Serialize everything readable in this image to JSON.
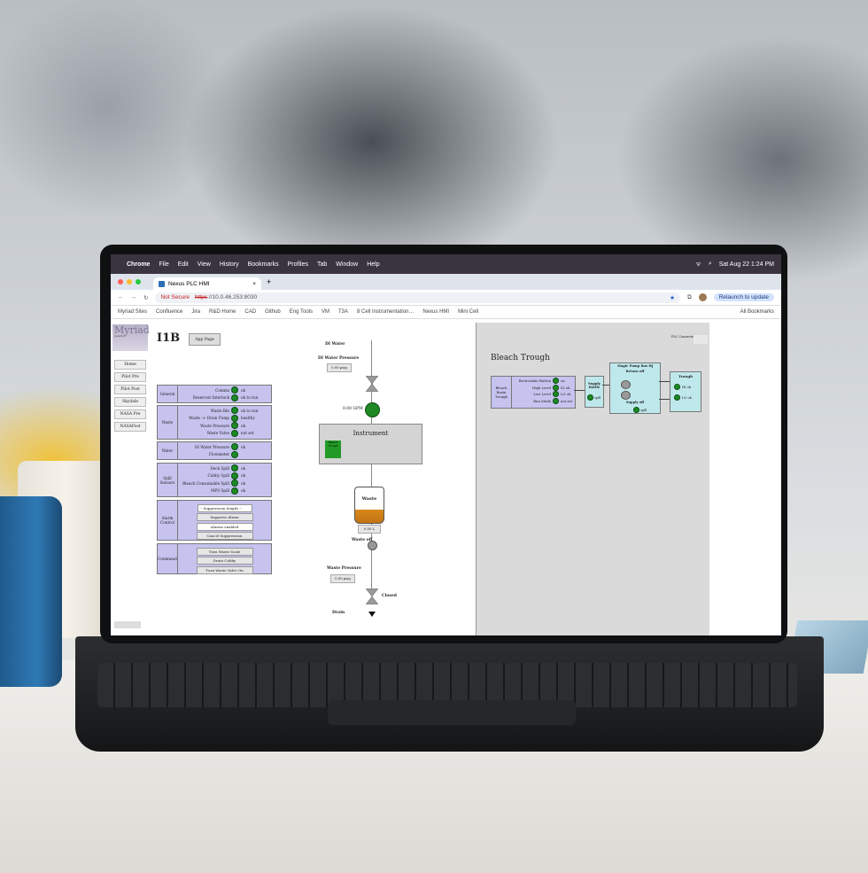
{
  "menubar": {
    "app": "Chrome",
    "items": [
      "File",
      "Edit",
      "View",
      "History",
      "Bookmarks",
      "Profiles",
      "Tab",
      "Window",
      "Help"
    ],
    "clock": "Sat Aug 22  1:24 PM"
  },
  "browser": {
    "tab_title": "Nexus PLC HMI",
    "new_tab": "+",
    "not_secure": "Not Secure",
    "url_proto": "https",
    "url_rest": "://10.0.46.253:8030",
    "relaunch": "Relaunch to update",
    "bookmarks": [
      "Myriad Sites",
      "Confluence",
      "Jira",
      "R&D Home",
      "CAD",
      "Github",
      "Eng Tools",
      "VM",
      "T3A",
      "8 Cell Instrumentation…",
      "Nexus HMI",
      "Mini Cell"
    ],
    "all_bookmarks": "All Bookmarks"
  },
  "nav": {
    "logo": "Myriad",
    "logo_sub": "genetics",
    "items": [
      "Home",
      "Pilot Pre",
      "Pilot Post",
      "Skydale",
      "NASA Pre",
      "NASAPost"
    ]
  },
  "page": {
    "title": "I1B",
    "app_page_button": "App Page"
  },
  "groups": {
    "general": {
      "label": "General",
      "rows": [
        {
          "name": "Comms",
          "value": "ok"
        },
        {
          "name": "Reservoir Interlock",
          "value": "ok to run"
        }
      ]
    },
    "waste": {
      "label": "Waste",
      "rows": [
        {
          "name": "Waste Bin",
          "value": "ok to run"
        },
        {
          "name": "Waste -> Drain Pump",
          "value": "healthy"
        },
        {
          "name": "Waste Pressure",
          "value": "ok"
        },
        {
          "name": "Waste Valve",
          "value": "not set"
        }
      ]
    },
    "water": {
      "label": "Water",
      "rows": [
        {
          "name": "DI Water Pressure",
          "value": "ok"
        },
        {
          "name": "Flowmeter",
          "value": ""
        }
      ]
    },
    "spill": {
      "label": "Spill Sensors",
      "rows": [
        {
          "name": "Deck Spill",
          "value": "ok"
        },
        {
          "name": "Cubby Spill",
          "value": "ok"
        },
        {
          "name": "Bleach Consumable Spill",
          "value": "ok"
        },
        {
          "name": "MPS Spill",
          "value": "ok"
        }
      ]
    },
    "alarm": {
      "label": "Alarm Control",
      "select_placeholder": "-- Suppression length --",
      "suppress": "Suppress Alarm",
      "status": "Alarms enabled",
      "cancel": "Cancel Suppression"
    },
    "command": {
      "label": "Command",
      "buttons": [
        "Turn Waste Scale",
        "Drain Cubby",
        "Turn Waste Valve On"
      ]
    }
  },
  "diagram": {
    "di_water": "DI Water",
    "di_pressure_label": "DI Water Pressure",
    "di_pressure_val": "0.00 psig",
    "flow": "0.00 GPM",
    "instrument": "Instrument",
    "instrument_sub": "Bleach Trough",
    "waste": "Waste",
    "waste_level": "0.00 L",
    "waste_valve": "Waste off",
    "waste_pressure_label": "Waste Pressure",
    "waste_pressure_val": "0.00 psig",
    "closed": "Closed",
    "drain": "Drain"
  },
  "bleach": {
    "plc": "PLC Connection",
    "title": "Bleach Trough",
    "box_label": "Bleach Basin Trough",
    "rows": [
      {
        "name": "Recirculate Button",
        "value": "on"
      },
      {
        "name": "High Level",
        "value": "IO ok"
      },
      {
        "name": "Low Level",
        "value": "LO ok"
      },
      {
        "name": "Run Mode",
        "value": "not set"
      }
    ],
    "supply_bottle": "Supply Bottle",
    "spill": "spill",
    "pump_box": "Magic Pump Box Hj",
    "return": "Return off",
    "supply": "Supply off",
    "trough": "Trough",
    "hi": "HI ok",
    "lo": "LO ok"
  },
  "colors": {
    "accent": "#c6c3ef",
    "ok_green": "#1c8a24",
    "cyan": "#bfe8ec"
  }
}
